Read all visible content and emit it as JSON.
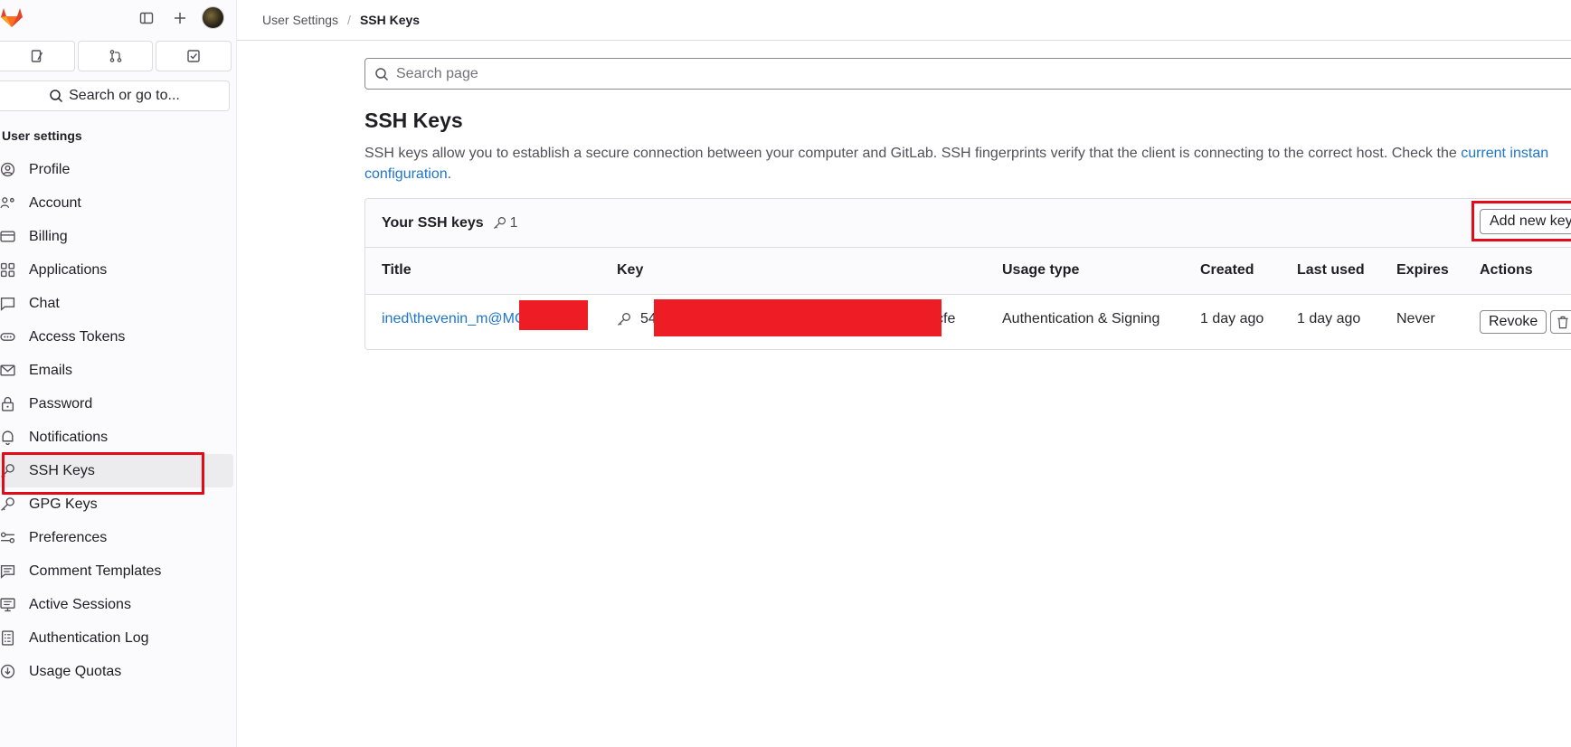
{
  "sidebar": {
    "tabs": [
      {
        "icon": "issues-icon"
      },
      {
        "icon": "merge-request-icon"
      },
      {
        "icon": "todo-icon"
      }
    ],
    "search_label": "Search or go to...",
    "section_title": "User settings",
    "items": [
      {
        "label": "Profile",
        "icon": "user-icon"
      },
      {
        "label": "Account",
        "icon": "account-icon"
      },
      {
        "label": "Billing",
        "icon": "credit-card-icon"
      },
      {
        "label": "Applications",
        "icon": "applications-icon"
      },
      {
        "label": "Chat",
        "icon": "chat-icon"
      },
      {
        "label": "Access Tokens",
        "icon": "token-icon"
      },
      {
        "label": "Emails",
        "icon": "mail-icon"
      },
      {
        "label": "Password",
        "icon": "lock-icon"
      },
      {
        "label": "Notifications",
        "icon": "bell-icon"
      },
      {
        "label": "SSH Keys",
        "icon": "key-icon"
      },
      {
        "label": "GPG Keys",
        "icon": "key-icon"
      },
      {
        "label": "Preferences",
        "icon": "preferences-icon"
      },
      {
        "label": "Comment Templates",
        "icon": "comment-icon"
      },
      {
        "label": "Active Sessions",
        "icon": "monitor-icon"
      },
      {
        "label": "Authentication Log",
        "icon": "log-icon"
      },
      {
        "label": "Usage Quotas",
        "icon": "quota-icon"
      }
    ],
    "active_item": "SSH Keys"
  },
  "breadcrumb": {
    "parent": "User Settings",
    "separator": "/",
    "current": "SSH Keys"
  },
  "main": {
    "search_placeholder": "Search page",
    "title": "SSH Keys",
    "description": "SSH keys allow you to establish a secure connection between your computer and GitLab. SSH fingerprints verify that the client is connecting to the correct host. Check the ",
    "description_link_1": "current instan",
    "description_link_2": "configuration",
    "description_end": "."
  },
  "keys_card": {
    "title": "Your SSH keys",
    "count": "1",
    "add_button": "Add new key",
    "columns": [
      "Title",
      "Key",
      "Usage type",
      "Created",
      "Last used",
      "Expires",
      "Actions"
    ],
    "rows": [
      {
        "title": "ined\\thevenin_m@MC",
        "key_prefix": "54",
        "key_suffix": "cfe",
        "usage_type": "Authentication & Signing",
        "created": "1 day ago",
        "last_used": "1 day ago",
        "expires": "Never",
        "revoke_label": "Revoke"
      }
    ]
  },
  "colors": {
    "link": "#1f75cb",
    "highlight_frame": "#e30b17",
    "redaction": "#ee1c25",
    "sidebar_bg": "#fbfafd"
  }
}
